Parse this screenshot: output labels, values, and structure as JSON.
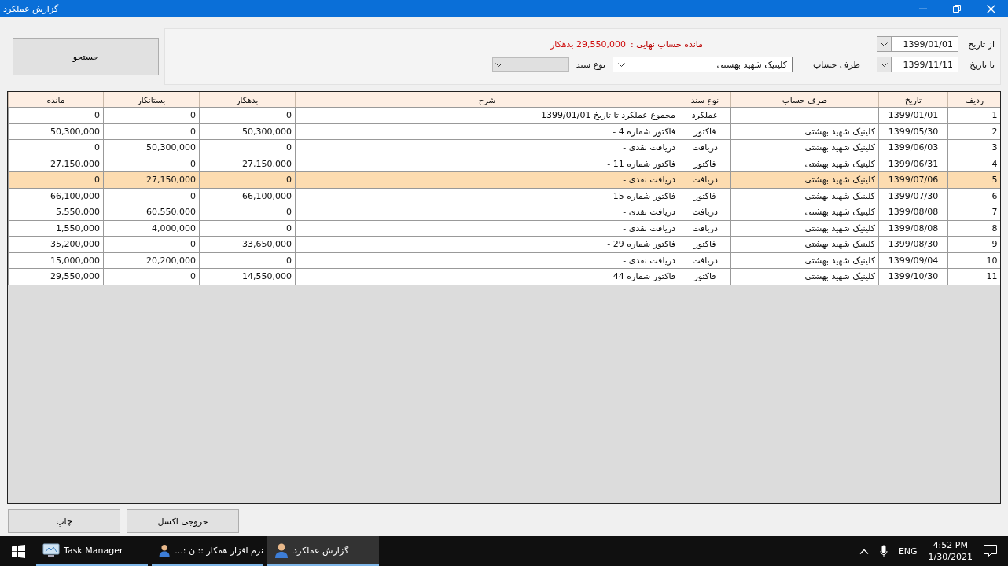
{
  "window": {
    "title": "گزارش عملکرد"
  },
  "search_button": "جستجو",
  "filters": {
    "from_label": "از تاریخ",
    "from_date": "1399/01/01",
    "to_label": "تا تاریخ",
    "to_date": "1399/11/11",
    "account_label": "طرف حساب",
    "account_value": "کلینیک شهید بهشتی",
    "doc_type_label": "نوع سند",
    "doc_type_disabled": true,
    "balance_label": "مانده حساب نهایی :",
    "balance_value": "29,550,000 بدهکار"
  },
  "table": {
    "columns": [
      "ردیف",
      "تاریخ",
      "طرف حساب",
      "نوع سند",
      "شرح",
      "بدهکار",
      "بستانکار",
      "مانده"
    ],
    "rows": [
      {
        "selected": false,
        "cells": [
          "1",
          "1399/01/01",
          "",
          "عملکرد",
          "مجموع عملکرد تا تاریخ 1399/01/01",
          "0",
          "0",
          "0"
        ]
      },
      {
        "selected": false,
        "cells": [
          "2",
          "1399/05/30",
          "کلینیک شهید بهشتی",
          "فاکتور",
          "فاکتور شماره 4 -",
          "50,300,000",
          "0",
          "50,300,000"
        ]
      },
      {
        "selected": false,
        "cells": [
          "3",
          "1399/06/03",
          "کلینیک شهید بهشتی",
          "دریافت",
          "دریافت نقدی -",
          "0",
          "50,300,000",
          "0"
        ]
      },
      {
        "selected": false,
        "cells": [
          "4",
          "1399/06/31",
          "کلینیک شهید بهشتی",
          "فاکتور",
          "فاکتور شماره 11 -",
          "27,150,000",
          "0",
          "27,150,000"
        ]
      },
      {
        "selected": true,
        "cells": [
          "5",
          "1399/07/06",
          "کلینیک شهید بهشتی",
          "دریافت",
          "دریافت نقدی -",
          "0",
          "27,150,000",
          "0"
        ]
      },
      {
        "selected": false,
        "cells": [
          "6",
          "1399/07/30",
          "کلینیک شهید بهشتی",
          "فاکتور",
          "فاکتور شماره 15 -",
          "66,100,000",
          "0",
          "66,100,000"
        ]
      },
      {
        "selected": false,
        "cells": [
          "7",
          "1399/08/08",
          "کلینیک شهید بهشتی",
          "دریافت",
          "دریافت نقدی -",
          "0",
          "60,550,000",
          "5,550,000"
        ]
      },
      {
        "selected": false,
        "cells": [
          "8",
          "1399/08/08",
          "کلینیک شهید بهشتی",
          "دریافت",
          "دریافت نقدی -",
          "0",
          "4,000,000",
          "1,550,000"
        ]
      },
      {
        "selected": false,
        "cells": [
          "9",
          "1399/08/30",
          "کلینیک شهید بهشتی",
          "فاکتور",
          "فاکتور شماره 29 -",
          "33,650,000",
          "0",
          "35,200,000"
        ]
      },
      {
        "selected": false,
        "cells": [
          "10",
          "1399/09/04",
          "کلینیک شهید بهشتی",
          "دریافت",
          "دریافت نقدی -",
          "0",
          "20,200,000",
          "15,000,000"
        ]
      },
      {
        "selected": false,
        "cells": [
          "11",
          "1399/10/30",
          "کلینیک شهید بهشتی",
          "فاکتور",
          "فاکتور شماره 44 -",
          "14,550,000",
          "0",
          "29,550,000"
        ]
      }
    ]
  },
  "buttons": [
    "خروجی اکسل",
    "چاپ"
  ],
  "taskbar": {
    "items": [
      {
        "label": "گزارش عملکرد",
        "selected": true,
        "kind": "user"
      },
      {
        "label": "نرم افزار همکار :: ن :...",
        "selected": false,
        "kind": "user"
      },
      {
        "label": "Task Manager",
        "selected": false,
        "kind": "monitor"
      }
    ],
    "language": "ENG",
    "time": "4:52 PM",
    "date": "1/30/2021"
  }
}
